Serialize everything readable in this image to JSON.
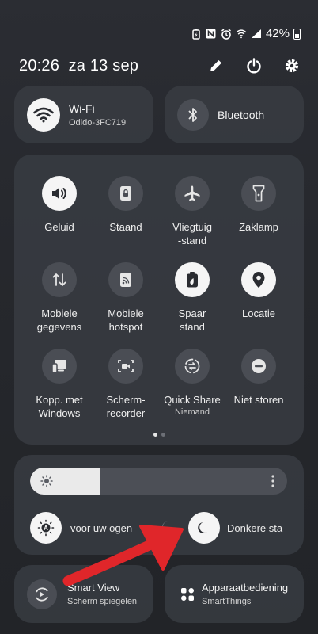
{
  "status_bar": {
    "battery_percent": "42%",
    "icons": [
      "battery-saver-icon",
      "nfc-icon",
      "alarm-icon",
      "wifi-icon",
      "signal-icon",
      "battery-icon"
    ]
  },
  "header": {
    "time": "20:26",
    "date": "za 13 sep",
    "icons": [
      "edit-icon",
      "power-icon",
      "settings-icon"
    ]
  },
  "wifi": {
    "title": "Wi-Fi",
    "network": "Odido-3FC719",
    "state": "on"
  },
  "bluetooth": {
    "title": "Bluetooth",
    "state": "off"
  },
  "quick_tiles": [
    {
      "label": "Geluid",
      "icon": "volume-icon",
      "state": "on"
    },
    {
      "label": "Staand",
      "icon": "rotation-lock-icon",
      "state": "off"
    },
    {
      "label": "Vliegtuig\n-stand",
      "icon": "airplane-icon",
      "state": "off"
    },
    {
      "label": "Zaklamp",
      "icon": "flashlight-icon",
      "state": "off"
    },
    {
      "label": "Mobiele\ngegevens",
      "icon": "mobile-data-icon",
      "state": "off"
    },
    {
      "label": "Mobiele\nhotspot",
      "icon": "hotspot-icon",
      "state": "off"
    },
    {
      "label": "Spaar\nstand",
      "icon": "power-saving-icon",
      "state": "on"
    },
    {
      "label": "Locatie",
      "icon": "location-icon",
      "state": "on"
    },
    {
      "label": "Kopp. met\nWindows",
      "icon": "link-windows-icon",
      "state": "off"
    },
    {
      "label": "Scherm-\nrecorder",
      "icon": "screen-recorder-icon",
      "state": "off"
    },
    {
      "label": "Quick Share",
      "sub": "Niemand",
      "icon": "quick-share-icon",
      "state": "off"
    },
    {
      "label": "Niet storen",
      "icon": "do-not-disturb-icon",
      "state": "off"
    }
  ],
  "page_indicator": {
    "pages": 2,
    "active": 0
  },
  "brightness": {
    "level": 0.27
  },
  "eye_comfort": {
    "label": "voor uw ogen"
  },
  "dark_mode": {
    "label": "Donkere sta"
  },
  "smart_view": {
    "title": "Smart View",
    "sub": "Scherm spiegelen"
  },
  "device_control": {
    "title": "Apparaatbediening",
    "sub": "SmartThings"
  },
  "colors": {
    "annotation_arrow": "#e0262a",
    "tile_on": "#f5f5f5",
    "tile_off": "#4a4d54"
  }
}
